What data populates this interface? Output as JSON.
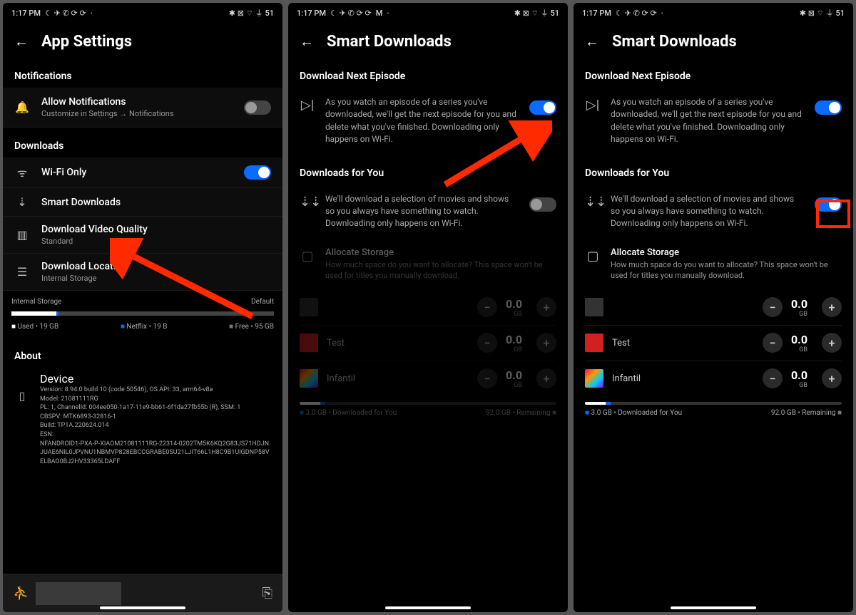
{
  "status": {
    "time": "1:17 PM",
    "left_icons": "☾  ✈  ✆  ⟳  ⟳",
    "right_icons": "✱  ⊠  ⌔  ⏚  51"
  },
  "s1": {
    "title": "App Settings",
    "notif_h": "Notifications",
    "notif_label": "Allow Notifications",
    "notif_sub": "Customize in Settings → Notifications",
    "dl_h": "Downloads",
    "wifi": "Wi-Fi Only",
    "smart": "Smart Downloads",
    "vq": "Download Video Quality",
    "vq_sub": "Standard",
    "loc": "Download Location",
    "loc_sub": "Internal Storage",
    "stor_h": "Internal Storage",
    "stor_default": "Default",
    "leg_used": "Used • 19 GB",
    "leg_nf": "Netflix • 19 B",
    "leg_free": "Free • 95 GB",
    "about_h": "About",
    "device": "Device",
    "about_lines": "Version: 8.94.0 build 10 (code 50546), OS API: 33, arm64-v8a\nModel: 21081111RG\nPL: 1, ChannelId: 004ee050-1a17-11e9-bb61-6f1da27fb55b (R), SSM: 1\nCBSPV: MTK6893-32816-1\nBuild: TP1A.220624.014\nESN:\nNFANDROID1-PXA-P-XIAOM21081111RG-22314-0202TM5K6KQ2G83JS71HDJNJUAE6NIL0JPVNU1NBMVP828EBCCGRABE0SU21LJIT66L1H8C9B1UIGDNP58VELBAO0BJ2HV33365LDAFF"
  },
  "s2": {
    "title": "Smart Downloads",
    "dne_h": "Download Next Episode",
    "dne_desc": "As you watch an episode of a series you've downloaded, we'll get the next episode for you and delete what you've finished. Downloading only happens on Wi-Fi.",
    "dfy_h": "Downloads for You",
    "dfy_desc": "We'll download a selection of movies and shows so you always have something to watch. Downloading only happens on Wi-Fi.",
    "alloc_t": "Allocate Storage",
    "alloc_desc": "How much space do you want to allocate? This space won't be used for titles you manually download.",
    "p1": "",
    "p2": "Test",
    "p3": "Infantil",
    "gb": "0.0",
    "gb_u": "GB",
    "prog_left": "3.0 GB • Downloaded for You",
    "prog_right": "92.0 GB • Remaining"
  }
}
